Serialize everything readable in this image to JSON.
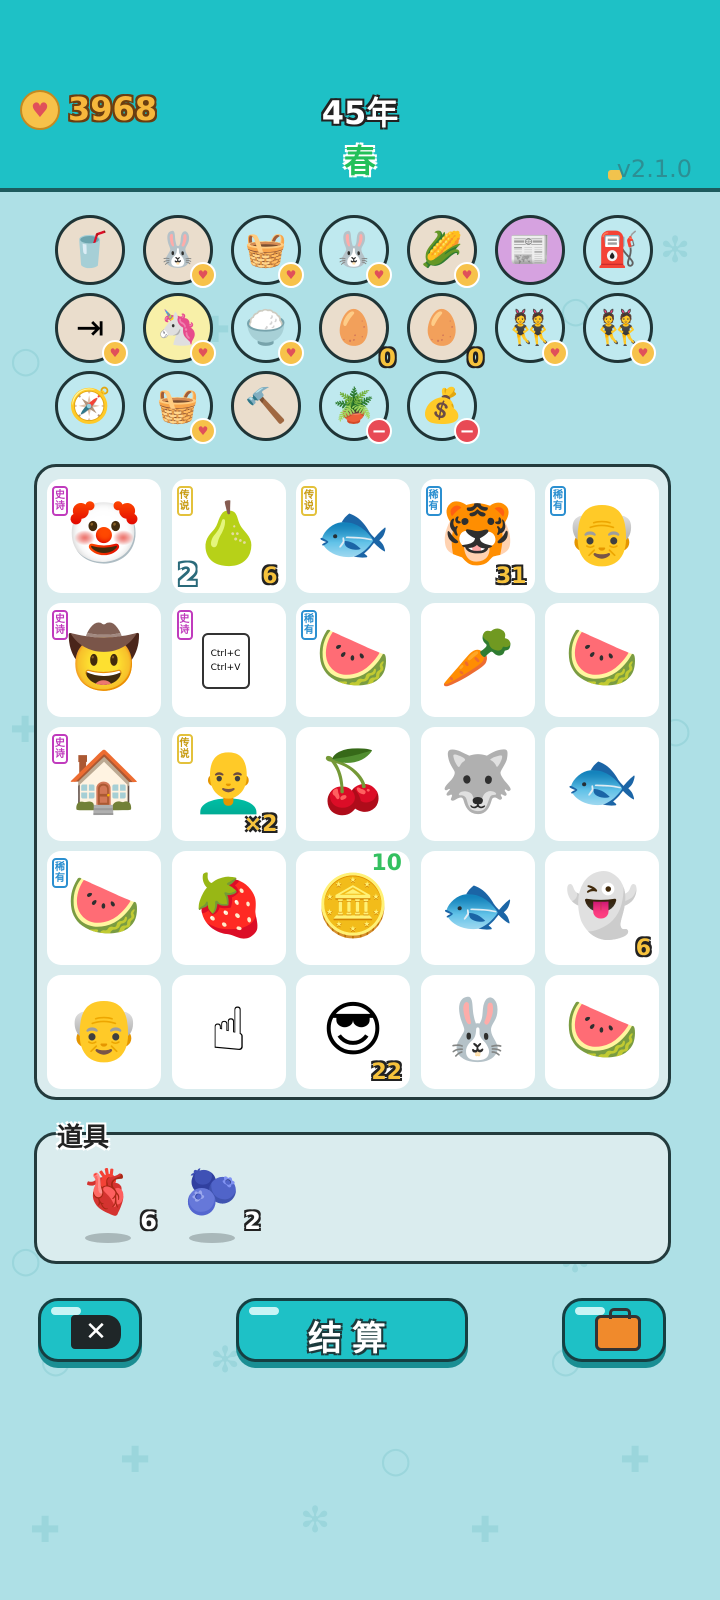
{
  "header": {
    "coins": "3968",
    "year": "45年",
    "season": "春",
    "version": "v2.1.0"
  },
  "owned_items": [
    {
      "icon": "bubble-tea-cup-icon",
      "glyph": "🥤",
      "bg": "#eaddcc"
    },
    {
      "icon": "rabbit-icon",
      "glyph": "🐰",
      "bg": "#eaddcc",
      "badge": "heart"
    },
    {
      "icon": "fruit-basket-icon",
      "glyph": "🧺",
      "bg": "#bfe9ef",
      "badge": "heart"
    },
    {
      "icon": "rabbit-icon",
      "glyph": "🐰",
      "bg": "#bfe9ef",
      "badge": "heart"
    },
    {
      "icon": "corn-icon",
      "glyph": "🌽",
      "bg": "#eaddcc",
      "badge": "heart"
    },
    {
      "icon": "time-magazine-icon",
      "glyph": "📰",
      "bg": "#d6a2e0"
    },
    {
      "icon": "air-pump-icon",
      "glyph": "⛽",
      "bg": "#bfe9ef"
    },
    {
      "icon": "next-arrow-icon",
      "glyph": "⇥",
      "bg": "#eaddcc",
      "badge": "heart"
    },
    {
      "icon": "unicorn-icon",
      "glyph": "🦄",
      "bg": "#f8f0a8",
      "badge": "heart"
    },
    {
      "icon": "rice-bowl-icon",
      "glyph": "🍚",
      "bg": "#bfe9ef",
      "badge": "heart"
    },
    {
      "icon": "egg-tray-icon",
      "glyph": "🥚",
      "bg": "#eaddcc",
      "count": "0"
    },
    {
      "icon": "egg-tray-icon",
      "glyph": "🥚",
      "bg": "#eaddcc",
      "count": "0"
    },
    {
      "icon": "milkmaid-icon",
      "glyph": "👯",
      "bg": "#bfe9ef",
      "badge": "heart"
    },
    {
      "icon": "milkmaid-icon",
      "glyph": "👯",
      "bg": "#bfe9ef",
      "badge": "heart"
    },
    {
      "icon": "compass-icon",
      "glyph": "🧭",
      "bg": "#bfe9ef"
    },
    {
      "icon": "fruit-basket-icon",
      "glyph": "🧺",
      "bg": "#bfe9ef",
      "badge": "heart"
    },
    {
      "icon": "hammer-icon",
      "glyph": "🔨",
      "bg": "#eaddcc"
    },
    {
      "icon": "potted-flower-icon",
      "glyph": "🪴",
      "bg": "#bfe9ef",
      "badge": "minus"
    },
    {
      "icon": "sack-icon",
      "glyph": "💰",
      "bg": "#bfe9ef",
      "badge": "minus"
    }
  ],
  "board": [
    {
      "icon": "clown-face-icon",
      "glyph": "🤡",
      "rarity": "史诗",
      "rarity_type": "epic"
    },
    {
      "icon": "pear-icon",
      "glyph": "🍐",
      "rarity": "传说",
      "rarity_type": "legend",
      "count_left": "2",
      "count_right": "6"
    },
    {
      "icon": "koi-fish-icon",
      "glyph": "🐟",
      "rarity": "传说",
      "rarity_type": "legend"
    },
    {
      "icon": "tiger-cat-icon",
      "glyph": "🐯",
      "rarity": "稀有",
      "rarity_type": "rare",
      "count_right": "31"
    },
    {
      "icon": "bald-man-icon",
      "glyph": "👴",
      "rarity": "稀有",
      "rarity_type": "rare"
    },
    {
      "icon": "farmer-icon",
      "glyph": "🤠",
      "rarity": "史诗",
      "rarity_type": "epic"
    },
    {
      "icon": "copy-paste-icon",
      "glyph": "",
      "rarity": "史诗",
      "rarity_type": "epic",
      "text": "Ctrl+C Ctrl+V"
    },
    {
      "icon": "watermelon-slice-icon",
      "glyph": "🍉",
      "rarity": "稀有",
      "rarity_type": "rare"
    },
    {
      "icon": "carrot-icon",
      "glyph": "🥕"
    },
    {
      "icon": "watermelon-icon",
      "glyph": "🍉"
    },
    {
      "icon": "rabbit-house-icon",
      "glyph": "🏠",
      "rarity": "史诗",
      "rarity_type": "epic"
    },
    {
      "icon": "rich-old-man-icon",
      "glyph": "👨‍🦲",
      "rarity": "传说",
      "rarity_type": "legend",
      "count_right": "×2"
    },
    {
      "icon": "cherry-icon",
      "glyph": "🍒"
    },
    {
      "icon": "husky-icon",
      "glyph": "🐺"
    },
    {
      "icon": "koi-fish-icon",
      "glyph": "🐟"
    },
    {
      "icon": "watermelon-slice-icon",
      "glyph": "🍉",
      "rarity": "稀有",
      "rarity_type": "rare"
    },
    {
      "icon": "lychee-icon",
      "glyph": "🍓"
    },
    {
      "icon": "gold-coin-icon",
      "glyph": "🪙",
      "count_top": "10"
    },
    {
      "icon": "koi-fish-icon",
      "glyph": "🐟"
    },
    {
      "icon": "ghost-icon",
      "glyph": "👻",
      "count_right": "6"
    },
    {
      "icon": "angry-old-man-icon",
      "glyph": "👴"
    },
    {
      "icon": "pointing-hand-icon",
      "glyph": "☝"
    },
    {
      "icon": "sunglasses-man-icon",
      "glyph": "😎",
      "count_right": "22"
    },
    {
      "icon": "rabbit-icon",
      "glyph": "🐰"
    },
    {
      "icon": "watermelon-slice-icon",
      "glyph": "🍉"
    }
  ],
  "props": {
    "title": "道具",
    "items": [
      {
        "icon": "liver-icon",
        "glyph": "🫀",
        "qty": "6"
      },
      {
        "icon": "blueberry-icon",
        "glyph": "🫐",
        "qty": "2"
      }
    ]
  },
  "buttons": {
    "close_glyph": "✕",
    "settle_label": "结算"
  }
}
